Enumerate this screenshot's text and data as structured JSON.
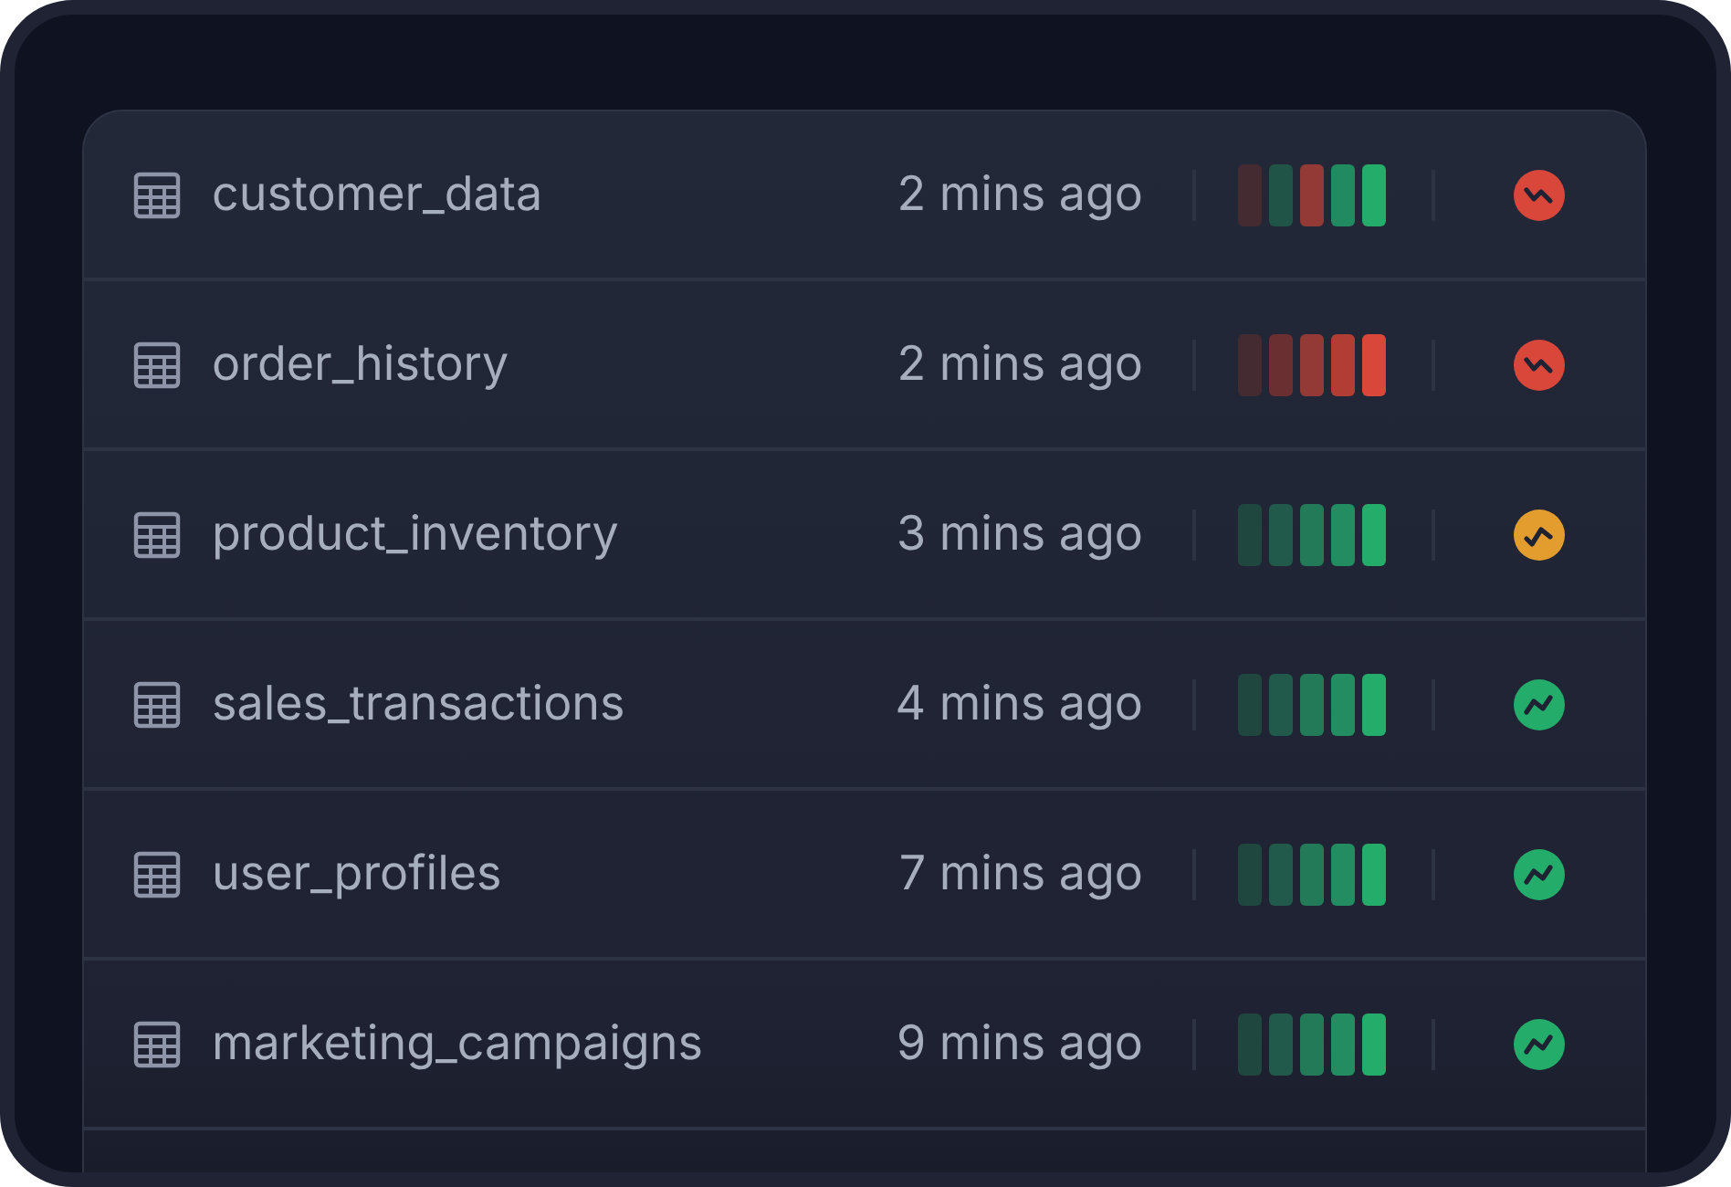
{
  "tables": [
    {
      "name": "customer_data",
      "updated": "2 mins ago",
      "bars": [
        {
          "color": "#442a31"
        },
        {
          "color": "#1f5446"
        },
        {
          "color": "#933a37"
        },
        {
          "color": "#218a60"
        },
        {
          "color": "#23ac6a"
        }
      ],
      "status": {
        "kind": "down",
        "color": "#d9463a"
      }
    },
    {
      "name": "order_history",
      "updated": "2 mins ago",
      "bars": [
        {
          "color": "#442a31"
        },
        {
          "color": "#6a2f31"
        },
        {
          "color": "#933a37"
        },
        {
          "color": "#b13d35"
        },
        {
          "color": "#d9463a"
        }
      ],
      "status": {
        "kind": "down",
        "color": "#d9463a"
      }
    },
    {
      "name": "product_inventory",
      "updated": "3 mins ago",
      "bars": [
        {
          "color": "#1f4740"
        },
        {
          "color": "#215a4a"
        },
        {
          "color": "#237a58"
        },
        {
          "color": "#238c60"
        },
        {
          "color": "#23ac6a"
        }
      ],
      "status": {
        "kind": "warning",
        "color": "#e29d2e"
      }
    },
    {
      "name": "sales_transactions",
      "updated": "4 mins ago",
      "bars": [
        {
          "color": "#1f4740"
        },
        {
          "color": "#215a4a"
        },
        {
          "color": "#237a58"
        },
        {
          "color": "#238c60"
        },
        {
          "color": "#23ac6a"
        }
      ],
      "status": {
        "kind": "up",
        "color": "#23ac6a"
      }
    },
    {
      "name": "user_profiles",
      "updated": "7 mins ago",
      "bars": [
        {
          "color": "#1f4740"
        },
        {
          "color": "#215a4a"
        },
        {
          "color": "#237a58"
        },
        {
          "color": "#238c60"
        },
        {
          "color": "#23ac6a"
        }
      ],
      "status": {
        "kind": "up",
        "color": "#23ac6a"
      }
    },
    {
      "name": "marketing_campaigns",
      "updated": "9 mins ago",
      "bars": [
        {
          "color": "#1f4740"
        },
        {
          "color": "#215a4a"
        },
        {
          "color": "#237a58"
        },
        {
          "color": "#238c60"
        },
        {
          "color": "#23ac6a"
        }
      ],
      "status": {
        "kind": "up",
        "color": "#23ac6a"
      }
    }
  ]
}
